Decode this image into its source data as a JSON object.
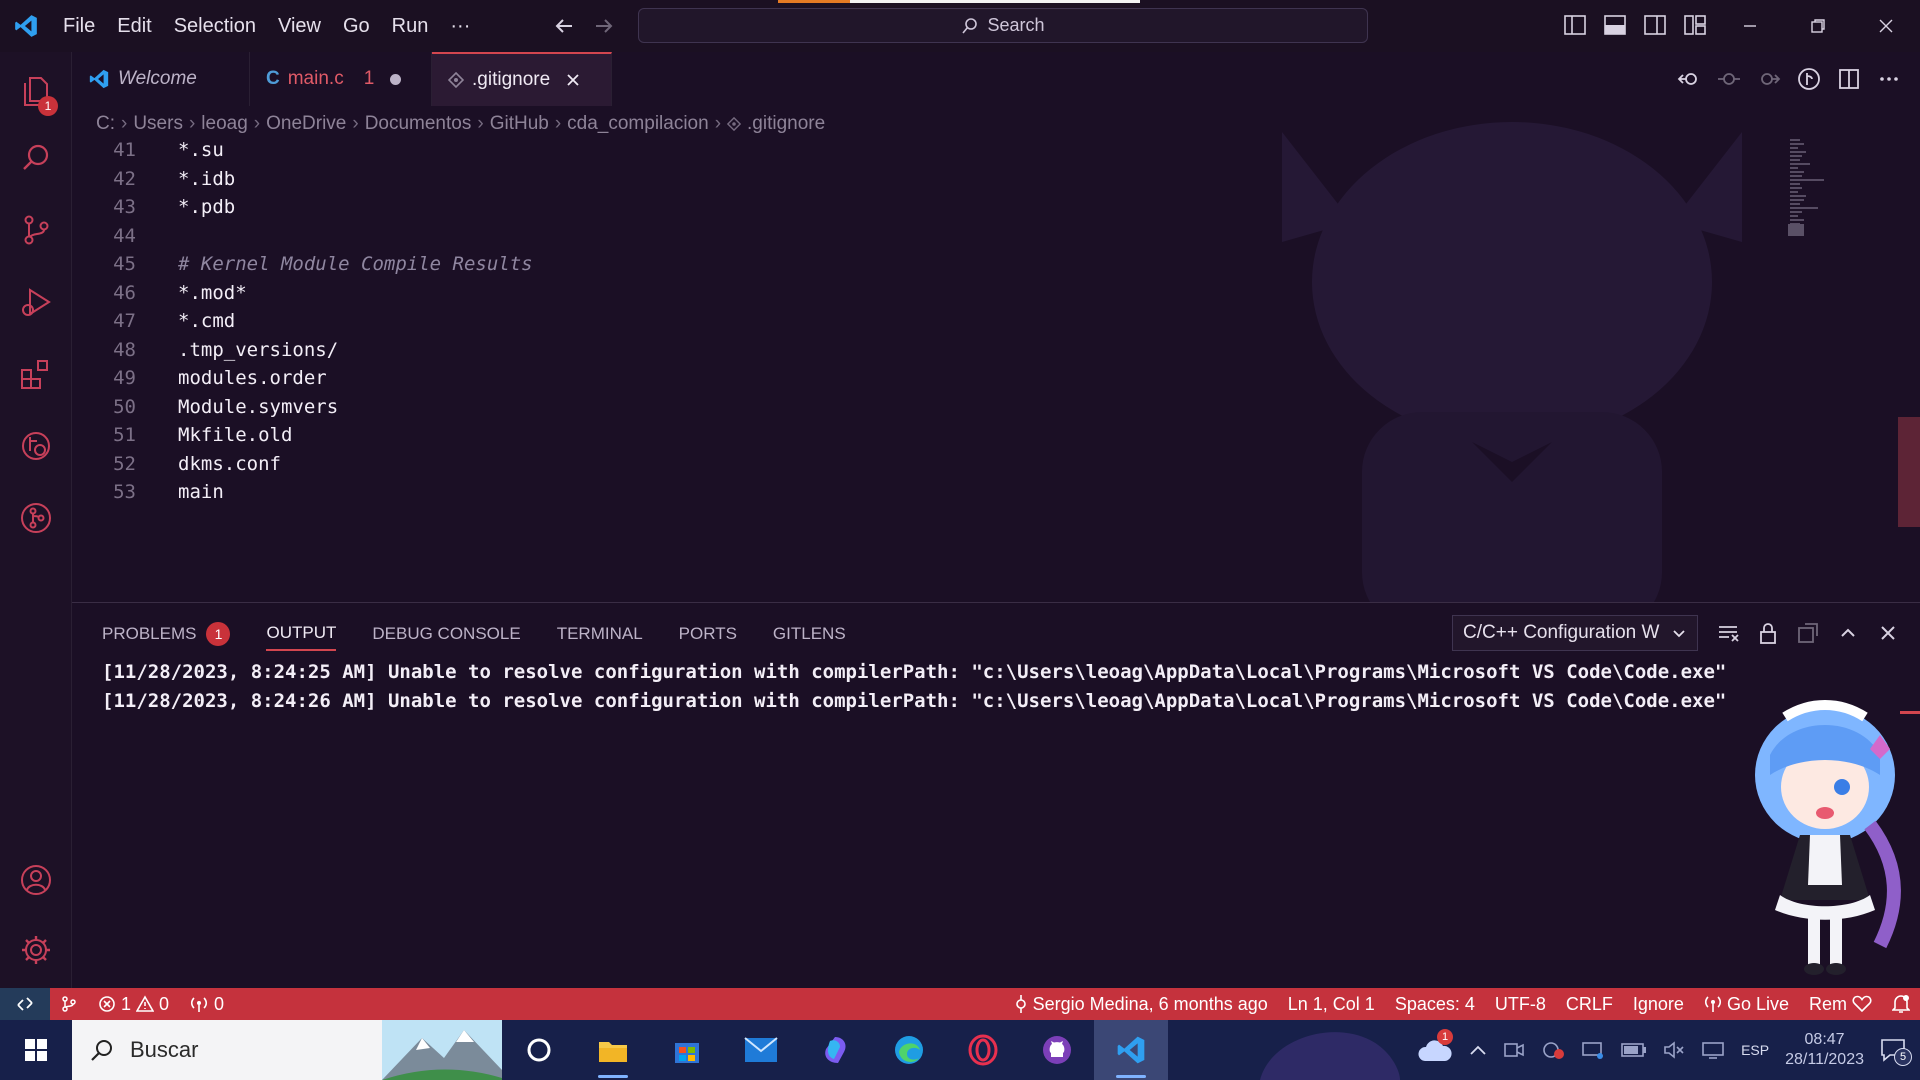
{
  "menu": [
    "File",
    "Edit",
    "Selection",
    "View",
    "Go",
    "Run",
    "···"
  ],
  "search": {
    "label": "Search"
  },
  "tabs": [
    {
      "label": "Welcome"
    },
    {
      "label": "main.c",
      "problems": "1"
    },
    {
      "label": ".gitignore"
    }
  ],
  "breadcrumb": [
    "C:",
    "Users",
    "leoag",
    "OneDrive",
    "Documentos",
    "GitHub",
    "cda_compilacion",
    ".gitignore"
  ],
  "activity": {
    "explorer_badge": "1"
  },
  "code_lines": [
    {
      "n": "41",
      "t": "*.su"
    },
    {
      "n": "42",
      "t": "*.idb"
    },
    {
      "n": "43",
      "t": "*.pdb"
    },
    {
      "n": "44",
      "t": ""
    },
    {
      "n": "45",
      "t": "# Kernel Module Compile Results"
    },
    {
      "n": "46",
      "t": "*.mod*"
    },
    {
      "n": "47",
      "t": "*.cmd"
    },
    {
      "n": "48",
      "t": ".tmp_versions/"
    },
    {
      "n": "49",
      "t": "modules.order"
    },
    {
      "n": "50",
      "t": "Module.symvers"
    },
    {
      "n": "51",
      "t": "Mkfile.old"
    },
    {
      "n": "52",
      "t": "dkms.conf"
    },
    {
      "n": "53",
      "t": "main"
    }
  ],
  "panel": {
    "tabs": [
      "PROBLEMS",
      "OUTPUT",
      "DEBUG CONSOLE",
      "TERMINAL",
      "PORTS",
      "GITLENS"
    ],
    "problems_count": "1",
    "output_channel": "C/C++ Configuration W",
    "output_lines": [
      "[11/28/2023, 8:24:25 AM] Unable to resolve configuration with compilerPath: \"c:\\Users\\leoag\\AppData\\Local\\Programs\\Microsoft VS Code\\Code.exe\"",
      "[11/28/2023, 8:24:26 AM] Unable to resolve configuration with compilerPath: \"c:\\Users\\leoag\\AppData\\Local\\Programs\\Microsoft VS Code\\Code.exe\""
    ]
  },
  "status": {
    "errors": "1",
    "warnings": "0",
    "ports": "0",
    "blame": "Sergio Medina, 6 months ago",
    "position": "Ln 1, Col 1",
    "spaces": "Spaces: 4",
    "encoding": "UTF-8",
    "eol": "CRLF",
    "language": "Ignore",
    "golive": "Go Live",
    "theme": "Rem"
  },
  "taskbar": {
    "search_placeholder": "Buscar",
    "weather_badge": "1",
    "lang": "ESP",
    "time": "08:47",
    "date": "28/11/2023",
    "notifications": "5"
  },
  "colors": {
    "accent": "#c5323d",
    "background": "#1b0f25",
    "taskbar": "#17204a"
  }
}
